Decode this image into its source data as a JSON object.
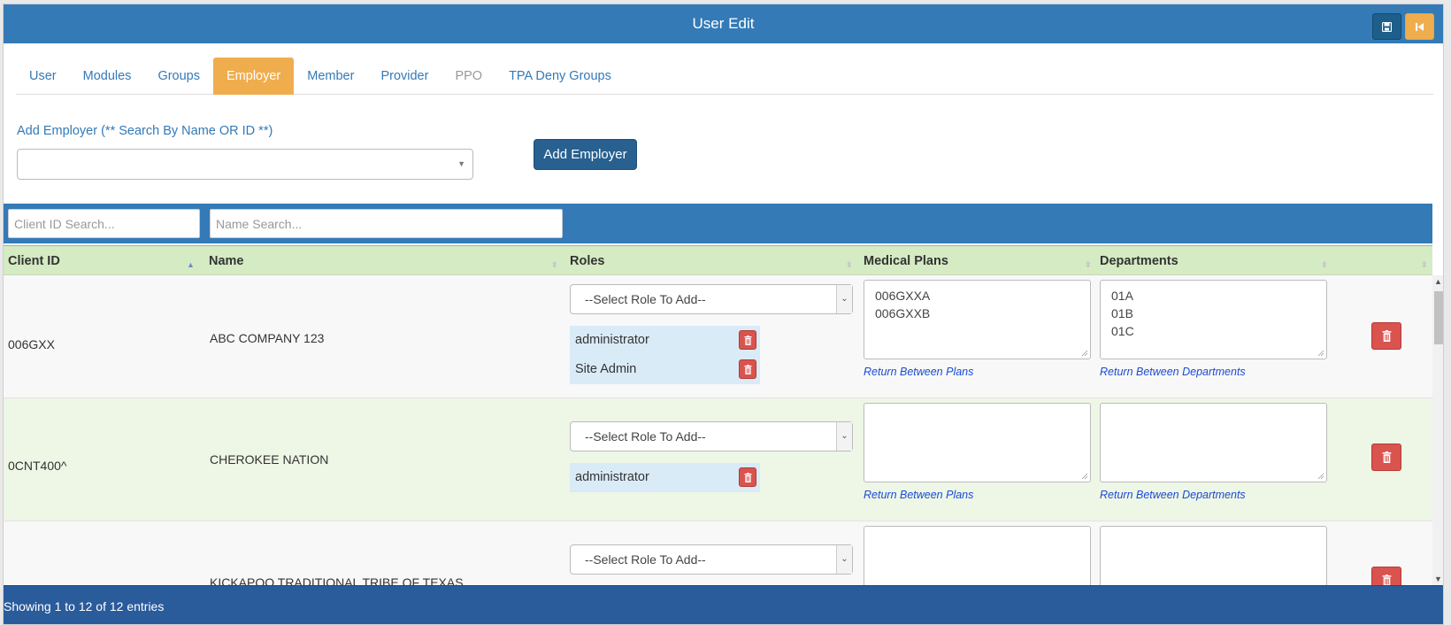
{
  "title": "User Edit",
  "header_buttons": {
    "save_icon": "save-icon",
    "back_icon": "step-backward-icon"
  },
  "tabs": [
    {
      "label": "User",
      "state": "normal"
    },
    {
      "label": "Modules",
      "state": "normal"
    },
    {
      "label": "Groups",
      "state": "normal"
    },
    {
      "label": "Employer",
      "state": "active"
    },
    {
      "label": "Member",
      "state": "normal"
    },
    {
      "label": "Provider",
      "state": "normal"
    },
    {
      "label": "PPO",
      "state": "disabled"
    },
    {
      "label": "TPA Deny Groups",
      "state": "normal"
    }
  ],
  "add_employer": {
    "label": "Add Employer (** Search By Name OR ID **)",
    "value": "",
    "button": "Add Employer"
  },
  "search": {
    "client_id_placeholder": "Client ID Search...",
    "name_placeholder": "Name Search..."
  },
  "table": {
    "columns": [
      "Client ID",
      "Name",
      "Roles",
      "Medical Plans",
      "Departments"
    ],
    "sorted_column": "Client ID",
    "role_select_placeholder": "--Select Role To Add--",
    "plans_hint": "Return Between Plans",
    "departments_hint": "Return Between Departments",
    "rows": [
      {
        "client_id": "006GXX",
        "name": "ABC COMPANY 123",
        "roles": [
          "administrator",
          "Site Admin"
        ],
        "medical_plans": [
          "006GXXA",
          "006GXXB"
        ],
        "departments": [
          "01A",
          "01B",
          "01C"
        ]
      },
      {
        "client_id": "0CNT400^",
        "name": "CHEROKEE NATION",
        "roles": [
          "administrator"
        ],
        "medical_plans": [],
        "departments": []
      },
      {
        "client_id": "",
        "name": "KICKAPOO TRADITIONAL TRIBE OF TEXAS",
        "roles": [],
        "medical_plans": [],
        "departments": []
      }
    ]
  },
  "footer": {
    "info": "Showing 1 to 12 of 12 entries"
  },
  "colors": {
    "header_blue": "#337ab7",
    "active_tab": "#f0ad4e",
    "table_header": "#d5ebc3",
    "delete_red": "#d9534f",
    "footer_blue": "#2a5b9b",
    "hint_link": "#1a4bd3"
  }
}
